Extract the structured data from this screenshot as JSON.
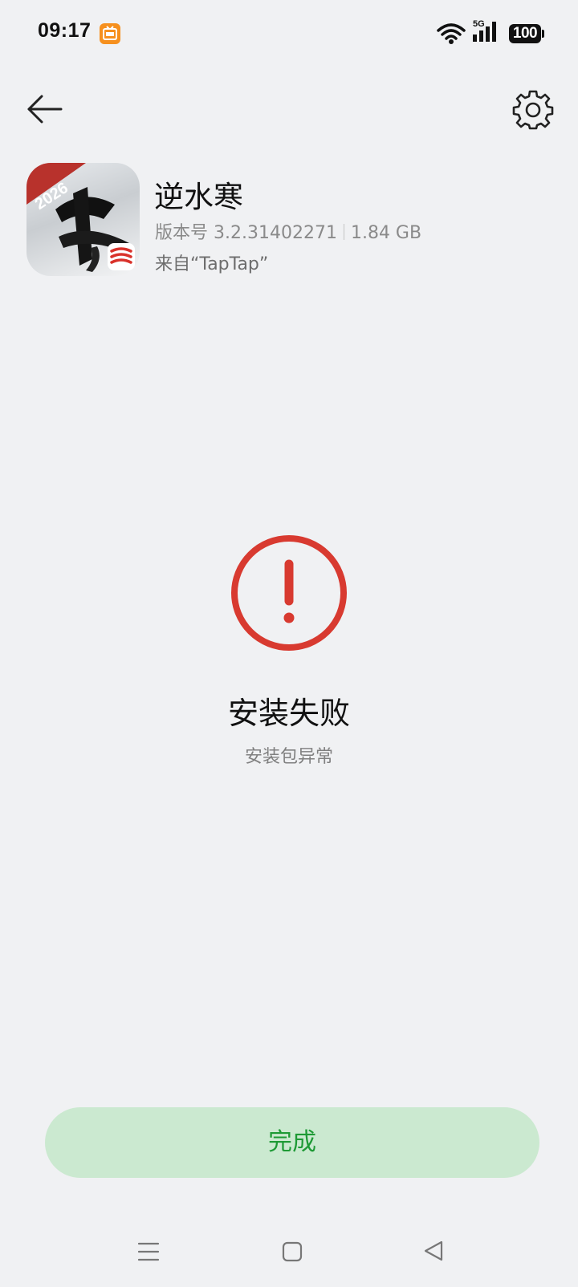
{
  "status_bar": {
    "time": "09:17",
    "network": "5G",
    "battery": "100",
    "icons": [
      "notification-app-icon",
      "wifi-icon",
      "signal-icon",
      "battery-icon"
    ]
  },
  "header": {
    "icons": [
      "back-arrow-icon",
      "gear-icon"
    ]
  },
  "app": {
    "name": "逆水寒",
    "version_label": "版本号 3.2.31402271",
    "size": "1.84 GB",
    "source": "来自“TapTap”",
    "icon_badge": "2026"
  },
  "result": {
    "title": "安装失败",
    "message": "安装包异常",
    "icon": "exclamation-circle-icon",
    "color": "#d83a30"
  },
  "actions": {
    "done_label": "完成",
    "accent": "#1e9a35",
    "button_bg": "#cbe9d0"
  },
  "nav_bar": {
    "icons": [
      "menu-icon",
      "home-icon",
      "back-triangle-icon"
    ]
  }
}
